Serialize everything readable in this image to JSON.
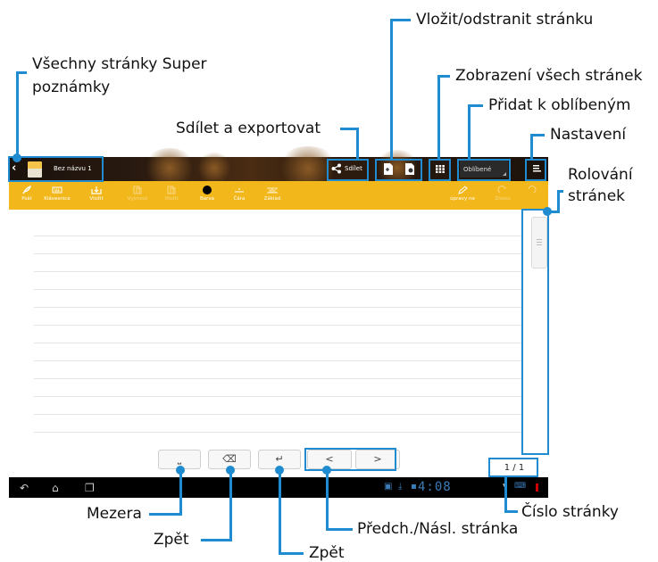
{
  "topbar": {
    "back_icon": "chevron-left-icon",
    "notebook_title": "Bez názvu 1",
    "share_label": "Sdílet",
    "favorites_label": "Oblíbené"
  },
  "toolbar": {
    "write": "Psát",
    "keyboard": "Klávesnice",
    "insert": "Vložit",
    "cut": "Vyjmout",
    "paste": "Vložit",
    "color": "Barva",
    "stroke": "Čára",
    "basic": "Základ",
    "edit": "úpravy ne",
    "redo": "Znovu"
  },
  "keys": {
    "space": "⎵",
    "backspace": "⌫",
    "enter": "↵",
    "prev": "<",
    "next": ">"
  },
  "page_number": "1 / 1",
  "status_clock": "4:08",
  "callouts": {
    "all_pages": "Všechny stránky Super poznámky",
    "all_pages_line1": "Všechny stránky Super",
    "all_pages_line2": "poznámky",
    "insert_remove": "Vložit/odstranit stránku",
    "view_all": "Zobrazení všech stránek",
    "add_favorite": "Přidat k oblíbeným",
    "share_export": "Sdílet a exportovat",
    "settings": "Nastavení",
    "scroll_line1": "Rolování",
    "scroll_line2": "stránek",
    "space": "Mezera",
    "backspace": "Zpět",
    "enter": "Zpět",
    "prev_next": "Předch./Násl. stránka",
    "page_number": "Číslo stránky"
  },
  "colors": {
    "accent": "#1f8bd0",
    "toolbar": "#f2b71a",
    "clock": "#3b7cb8"
  }
}
